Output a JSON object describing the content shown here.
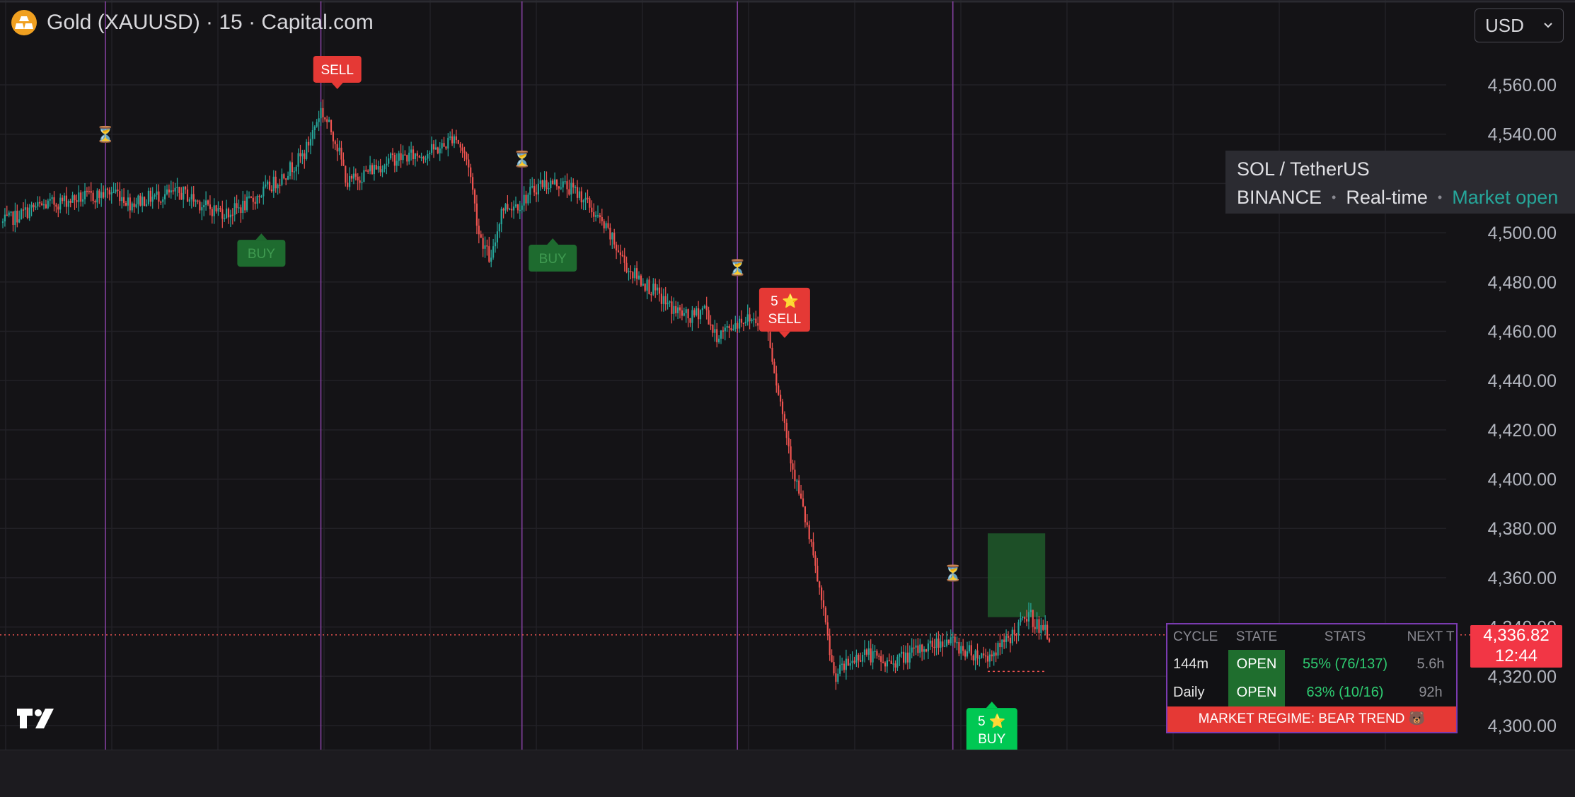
{
  "header": {
    "title": "Gold (XAUUSD) · 15 · Capital.com",
    "currency": "USD"
  },
  "symbol_panel": {
    "symbol": "SOL / TetherUS",
    "exchange": "BINANCE",
    "feed": "Real-time",
    "status": "Market open"
  },
  "price_tag": {
    "price": "4,336.82",
    "countdown": "12:44"
  },
  "table": {
    "headers": [
      "CYCLE",
      "STATE",
      "STATS",
      "NEXT T"
    ],
    "rows": [
      {
        "cycle": "144m",
        "state": "OPEN",
        "stats": "55% (76/137)",
        "next": "5.6h"
      },
      {
        "cycle": "Daily",
        "state": "OPEN",
        "stats": "63% (10/16)",
        "next": "92h"
      }
    ],
    "regime": "MARKET REGIME: BEAR TREND 🐻"
  },
  "colors": {
    "up": "#26a69a",
    "down": "#ef5350",
    "vline": "#8e44ad",
    "sell": "#e53935",
    "buy_strong": "#00c853",
    "buy_weak": "#1e6b2f",
    "zone": "#1e5a2a"
  },
  "chart_data": {
    "type": "candlestick",
    "ylim": [
      4290,
      4580
    ],
    "y_ticks": [
      4300,
      4320,
      4340,
      4360,
      4380,
      4400,
      4420,
      4440,
      4460,
      4480,
      4500,
      4520,
      4540,
      4560
    ],
    "y_tick_labels": [
      "4,300.00",
      "4,320.00",
      "4,340.00",
      "4,360.00",
      "4,380.00",
      "4,400.00",
      "4,420.00",
      "4,440.00",
      "4,460.00",
      "4,480.00",
      "4,500.00",
      "4,520.00",
      "4,540.00",
      "4,560.00"
    ],
    "last_price": 4336.82,
    "n_bars": 250,
    "close_path": [
      [
        0,
        4504
      ],
      [
        15,
        4510
      ],
      [
        30,
        4513
      ],
      [
        45,
        4515
      ],
      [
        55,
        4517
      ],
      [
        62,
        4512
      ],
      [
        75,
        4515
      ],
      [
        88,
        4516
      ],
      [
        100,
        4510
      ],
      [
        110,
        4508
      ],
      [
        120,
        4512
      ],
      [
        135,
        4522
      ],
      [
        147,
        4532
      ],
      [
        155,
        4550
      ],
      [
        162,
        4538
      ],
      [
        168,
        4520
      ],
      [
        178,
        4525
      ],
      [
        190,
        4530
      ],
      [
        205,
        4532
      ],
      [
        215,
        4535
      ],
      [
        220,
        4540
      ],
      [
        227,
        4528
      ],
      [
        232,
        4500
      ],
      [
        238,
        4488
      ],
      [
        243,
        4510
      ],
      [
        252,
        4512
      ],
      [
        262,
        4520
      ],
      [
        272,
        4520
      ],
      [
        282,
        4515
      ],
      [
        295,
        4500
      ],
      [
        305,
        4485
      ],
      [
        315,
        4478
      ],
      [
        325,
        4470
      ],
      [
        335,
        4465
      ],
      [
        342,
        4470
      ],
      [
        347,
        4458
      ],
      [
        352,
        4460
      ],
      [
        360,
        4465
      ],
      [
        372,
        4465
      ],
      [
        377,
        4440
      ],
      [
        385,
        4405
      ],
      [
        392,
        4380
      ],
      [
        398,
        4355
      ],
      [
        405,
        4320
      ],
      [
        412,
        4325
      ],
      [
        420,
        4330
      ],
      [
        430,
        4325
      ],
      [
        440,
        4328
      ],
      [
        450,
        4332
      ],
      [
        460,
        4335
      ],
      [
        470,
        4330
      ],
      [
        480,
        4328
      ],
      [
        488,
        4333
      ],
      [
        495,
        4340
      ],
      [
        500,
        4345
      ],
      [
        505,
        4340
      ],
      [
        510,
        4336.82
      ]
    ],
    "vertical_markers_bar": [
      50,
      155,
      253,
      358,
      463
    ],
    "hourglass_markers": [
      {
        "bar": 50,
        "price": 4540
      },
      {
        "bar": 155,
        "price": 4568
      },
      {
        "bar": 253,
        "price": 4530
      },
      {
        "bar": 358,
        "price": 4486
      },
      {
        "bar": 463,
        "price": 4362
      }
    ],
    "signals": [
      {
        "type": "BUY",
        "label": "BUY",
        "strength": "weak",
        "bar": 126,
        "price": 4500
      },
      {
        "type": "SELL",
        "label": "SELL",
        "strength": "normal",
        "bar": 163,
        "price": 4558
      },
      {
        "type": "BUY",
        "label": "BUY",
        "strength": "weak",
        "bar": 268,
        "price": 4498
      },
      {
        "type": "SELL",
        "label": "SELL",
        "score": "5",
        "strength": "strong",
        "bar": 381,
        "price": 4457
      },
      {
        "type": "BUY",
        "label": "BUY",
        "score": "5",
        "strength": "strong",
        "bar": 482,
        "price": 4310
      }
    ],
    "target_zone": {
      "bar_start": 480,
      "bar_end": 508,
      "price_low": 4344,
      "price_high": 4378
    },
    "target_level": {
      "bar_start": 480,
      "bar_end": 508,
      "price": 4322
    }
  }
}
